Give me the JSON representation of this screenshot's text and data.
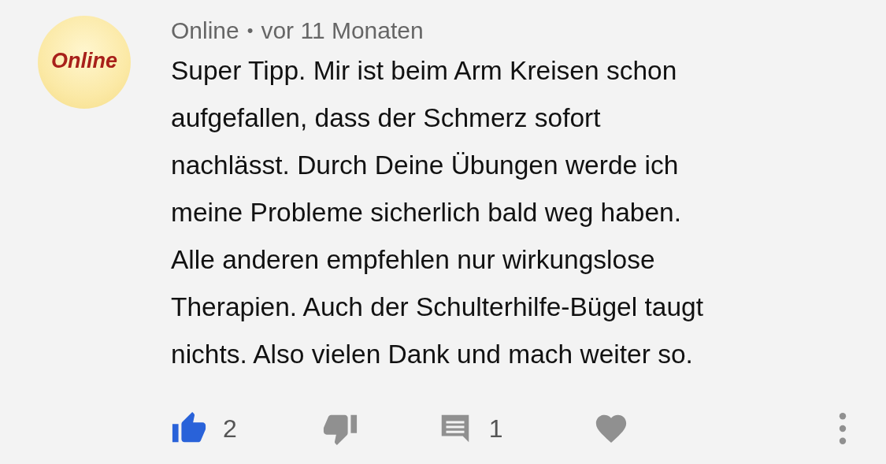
{
  "comment": {
    "avatar": {
      "text": "Online"
    },
    "author": "Online",
    "separator": "•",
    "time": "vor 11 Monaten",
    "text_lines": [
      "Super Tipp. Mir ist beim Arm Kreisen schon",
      "aufgefallen, dass der Schmerz sofort",
      "nachlässt. Durch Deine Übungen werde ich",
      "meine Probleme sicherlich bald weg haben.",
      "Alle anderen empfehlen nur wirkungslose",
      "Therapien. Auch der Schulterhilfe-Bügel taugt",
      "nichts. Also vielen Dank und mach weiter so."
    ],
    "like": {
      "selected": true,
      "count": "2"
    },
    "dislike": {
      "selected": false
    },
    "replies": {
      "count": "1"
    },
    "heart": {
      "selected": false
    }
  }
}
